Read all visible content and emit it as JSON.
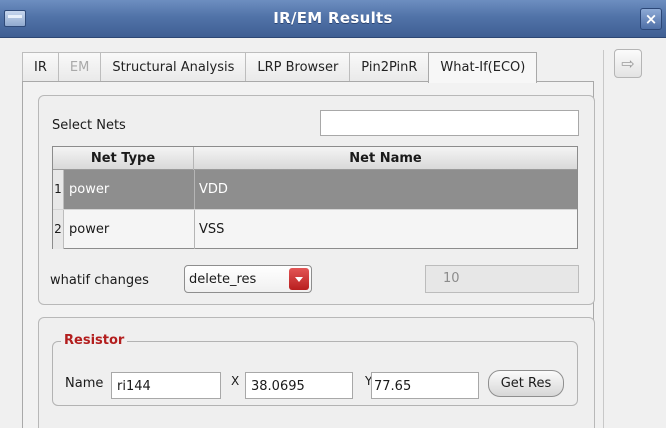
{
  "window": {
    "title": "IR/EM Results",
    "close_glyph": "×",
    "menu_icon": "window-menu-icon",
    "accent_color": "#5173a8"
  },
  "tabs": [
    {
      "label": "IR",
      "state": "normal"
    },
    {
      "label": "EM",
      "state": "disabled"
    },
    {
      "label": "Structural Analysis",
      "state": "normal"
    },
    {
      "label": "LRP Browser",
      "state": "normal"
    },
    {
      "label": "Pin2PinR",
      "state": "normal"
    },
    {
      "label": "What-If(ECO)",
      "state": "active"
    }
  ],
  "tab_scroll": {
    "glyph": "⇨",
    "icon": "arrow-right-icon"
  },
  "select_nets": {
    "label": "Select Nets",
    "value": ""
  },
  "net_table": {
    "columns": [
      "Net Type",
      "Net Name"
    ],
    "rows": [
      {
        "index": "1",
        "net_type": "power",
        "net_name": "VDD",
        "selected": true
      },
      {
        "index": "2",
        "net_type": "power",
        "net_name": "VSS",
        "selected": false
      }
    ],
    "selected_row_color": "#8e8e8e"
  },
  "whatif": {
    "label": "whatif changes",
    "selected": "delete_res",
    "dropdown_color": "#c62828",
    "value_field": "10"
  },
  "resistor": {
    "legend": "Resistor",
    "legend_color": "#b31e1e",
    "name_label": "Name",
    "name_value": "ri144",
    "x_label": "X",
    "x_value": "38.0695",
    "y_label": "Y",
    "y_value": "77.65",
    "button_label": "Get Res"
  }
}
